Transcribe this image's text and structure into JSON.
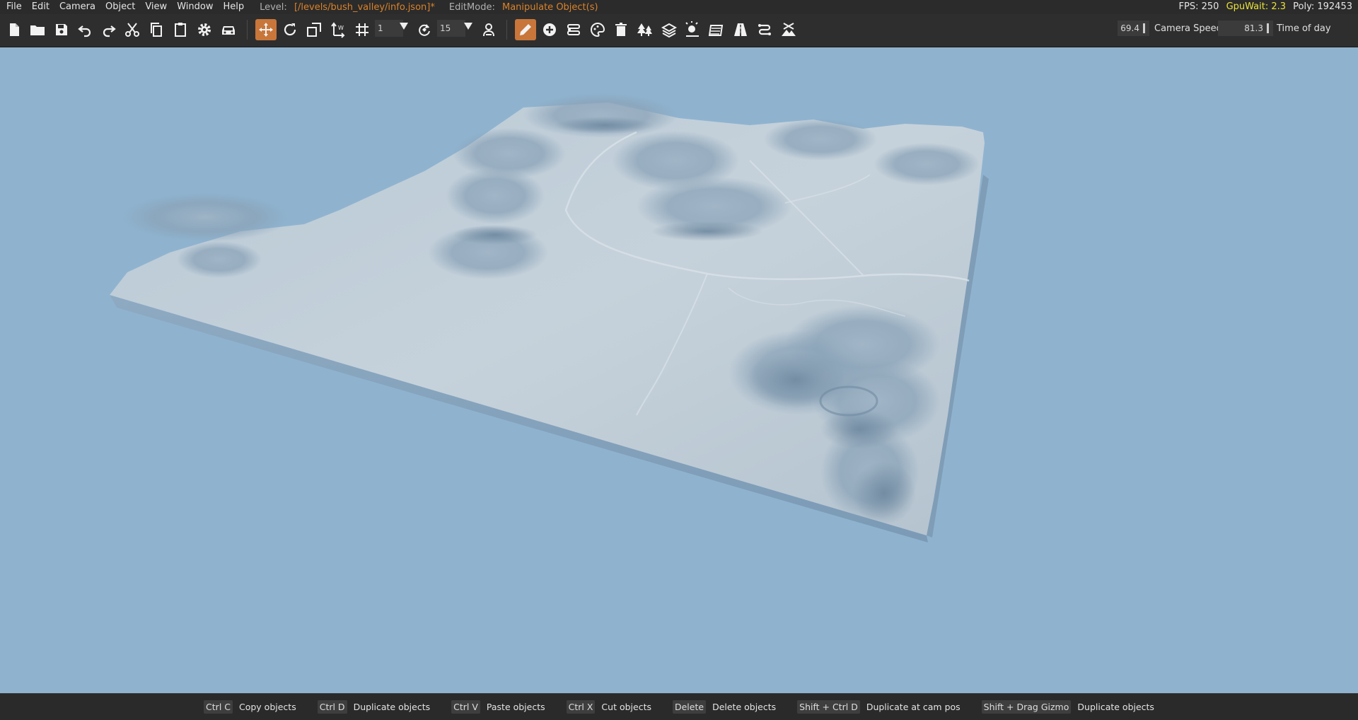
{
  "menu": [
    "File",
    "Edit",
    "Camera",
    "Object",
    "View",
    "Window",
    "Help"
  ],
  "level": {
    "label": "Level:",
    "path": "[/levels/bush_valley/info.json]*"
  },
  "edit_mode": {
    "label": "EditMode:",
    "value": "Manipulate Object(s)"
  },
  "stats": {
    "fps": "FPS: 250",
    "gpu_wait": "GpuWait: 2.3",
    "poly": "Poly: 192453"
  },
  "toolbar": {
    "icons": [
      "new-file-icon",
      "open-folder-icon",
      "save-icon",
      "undo-icon",
      "redo-icon",
      "cut-icon",
      "copy-icon",
      "paste-icon",
      "settings-icon",
      "vehicle-icon",
      "translate-gizmo-icon",
      "rotate-icon",
      "scale-icon",
      "axis-world-icon",
      "grid-snap-icon",
      "rotation-snap-icon",
      "lock-camera-icon",
      "edit-pencil-icon",
      "add-object-icon",
      "road-editor-icon",
      "color-palette-icon",
      "delete-icon",
      "forest-icon",
      "layers-icon",
      "sun-icon",
      "terrain-paint-icon",
      "road-icon",
      "decal-road-icon",
      "biome-icon"
    ],
    "grid_snap_value": "1",
    "rotation_snap_value": "15",
    "camera_speed_value": "69.4",
    "camera_speed_label": "Camera Speed",
    "time_of_day_value": "81.3",
    "time_of_day_label": "Time of day"
  },
  "colors": {
    "accent": "#c8763a",
    "sky": "#8fb3cf",
    "panel": "#2e2e2e"
  },
  "shortcuts": [
    {
      "key": "Ctrl C",
      "action": "Copy objects"
    },
    {
      "key": "Ctrl D",
      "action": "Duplicate objects"
    },
    {
      "key": "Ctrl V",
      "action": "Paste objects"
    },
    {
      "key": "Ctrl X",
      "action": "Cut objects"
    },
    {
      "key": "Delete",
      "action": "Delete objects"
    },
    {
      "key": "Shift + Ctrl D",
      "action": "Duplicate at cam pos"
    },
    {
      "key": "Shift + Drag Gizmo",
      "action": "Duplicate objects"
    }
  ]
}
